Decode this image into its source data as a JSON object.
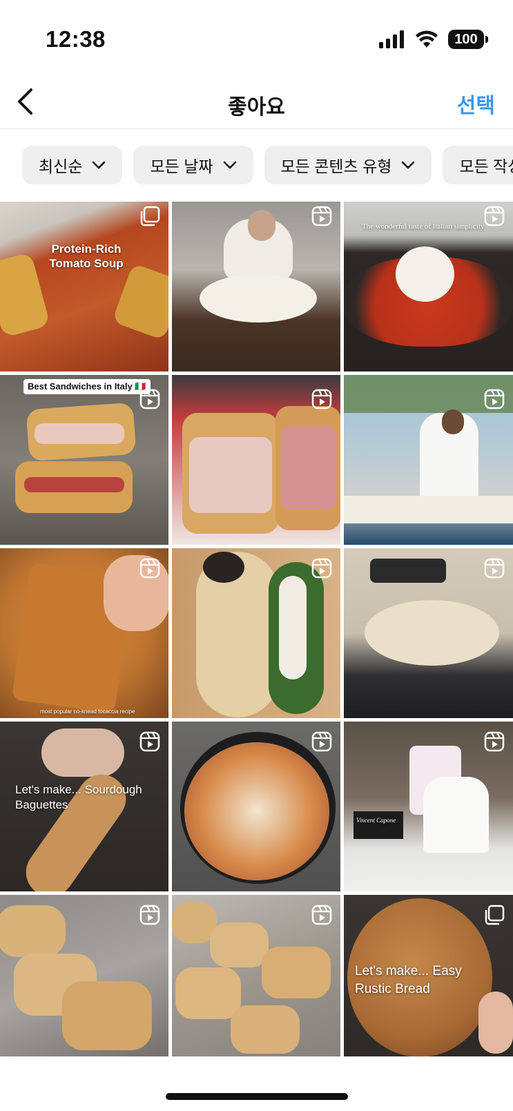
{
  "status_bar": {
    "time": "12:38",
    "battery": "100"
  },
  "nav": {
    "title": "좋아요",
    "select_label": "선택"
  },
  "filters": [
    {
      "label": "최신순"
    },
    {
      "label": "모든 날짜"
    },
    {
      "label": "모든 콘텐츠 유형"
    },
    {
      "label": "모든 작성"
    }
  ],
  "posts": [
    {
      "type": "carousel",
      "overlay_text": "Protein-Rich Tomato Soup"
    },
    {
      "type": "reel"
    },
    {
      "type": "reel",
      "overlay_text": "The wonderful taste of Italian simplicity"
    },
    {
      "type": "reel",
      "overlay_text": "Best Sandwiches in Italy 🇮🇹"
    },
    {
      "type": "reel"
    },
    {
      "type": "reel"
    },
    {
      "type": "reel",
      "overlay_text": "most popular no-knead focaccia recipe"
    },
    {
      "type": "reel"
    },
    {
      "type": "reel"
    },
    {
      "type": "reel",
      "overlay_text": "Let's make... Sourdough Baguettes"
    },
    {
      "type": "reel"
    },
    {
      "type": "reel",
      "overlay_text": "Vincent Capone"
    },
    {
      "type": "reel"
    },
    {
      "type": "reel"
    },
    {
      "type": "carousel",
      "overlay_text": "Let's make... Easy Rustic Bread"
    }
  ],
  "colors": {
    "accent": "#3797f0",
    "chip_bg": "#efefef"
  }
}
